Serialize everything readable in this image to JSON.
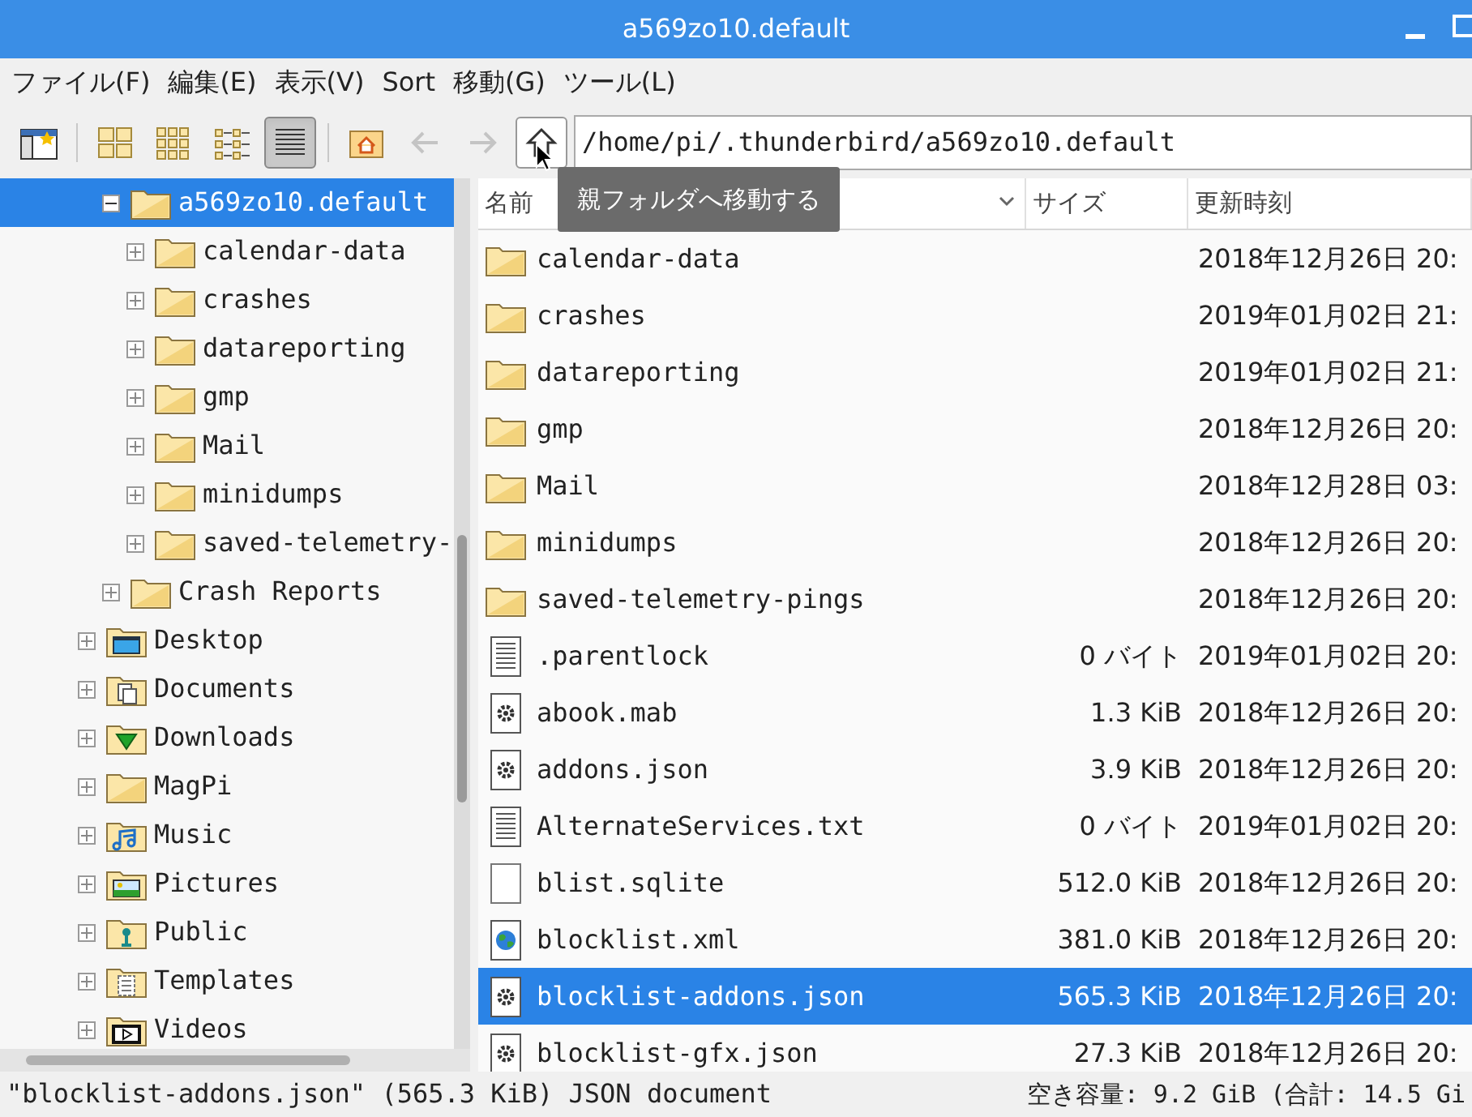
{
  "window": {
    "title": "a569zo10.default"
  },
  "menu": [
    "ファイル(F)",
    "編集(E)",
    "表示(V)",
    "Sort",
    "移動(G)",
    "ツール(L)"
  ],
  "toolbar": {
    "views": [
      {
        "kind": "icons",
        "selected": false
      },
      {
        "kind": "thumbs",
        "selected": false
      },
      {
        "kind": "compact",
        "selected": false
      },
      {
        "kind": "list",
        "selected": true
      }
    ],
    "back": {
      "disabled": true
    },
    "forward": {
      "disabled": true
    },
    "path": "/home/pi/.thunderbird/a569zo10.default",
    "tooltip": "親フォルダへ移動する"
  },
  "tree": {
    "scrolled_branch": [
      {
        "label": "a569zo10.default",
        "kind": "folder",
        "expanded": true,
        "selected": true,
        "children": [
          {
            "label": "calendar-data",
            "kind": "folder",
            "expanded": false,
            "selected": false
          },
          {
            "label": "crashes",
            "kind": "folder",
            "expanded": false,
            "selected": false
          },
          {
            "label": "datareporting",
            "kind": "folder",
            "expanded": false,
            "selected": false
          },
          {
            "label": "gmp",
            "kind": "folder",
            "expanded": false,
            "selected": false
          },
          {
            "label": "Mail",
            "kind": "folder",
            "expanded": false,
            "selected": false
          },
          {
            "label": "minidumps",
            "kind": "folder",
            "expanded": false,
            "selected": false
          },
          {
            "label": "saved-telemetry-",
            "kind": "folder",
            "expanded": false,
            "selected": false
          }
        ]
      },
      {
        "label": "Crash Reports",
        "kind": "folder",
        "expanded": false,
        "selected": false
      }
    ],
    "items": [
      {
        "label": "Desktop",
        "kind": "desktop",
        "expanded": false,
        "selected": false
      },
      {
        "label": "Documents",
        "kind": "documents",
        "expanded": false,
        "selected": false
      },
      {
        "label": "Downloads",
        "kind": "downloads",
        "expanded": false,
        "selected": false
      },
      {
        "label": "MagPi",
        "kind": "folder",
        "expanded": false,
        "selected": false
      },
      {
        "label": "Music",
        "kind": "music",
        "expanded": false,
        "selected": false
      },
      {
        "label": "Pictures",
        "kind": "pictures",
        "expanded": false,
        "selected": false
      },
      {
        "label": "Public",
        "kind": "public",
        "expanded": false,
        "selected": false
      },
      {
        "label": "Templates",
        "kind": "templates",
        "expanded": false,
        "selected": false
      },
      {
        "label": "Videos",
        "kind": "videos",
        "expanded": false,
        "selected": false
      }
    ]
  },
  "table": {
    "columns": [
      "名前",
      "サイズ",
      "更新時刻"
    ],
    "rows": [
      {
        "kind": "folder",
        "name": "calendar-data",
        "size": "",
        "date": "2018年12月26日 20:",
        "selected": false
      },
      {
        "kind": "folder",
        "name": "crashes",
        "size": "",
        "date": "2019年01月02日 21:",
        "selected": false
      },
      {
        "kind": "folder",
        "name": "datareporting",
        "size": "",
        "date": "2019年01月02日 21:",
        "selected": false
      },
      {
        "kind": "folder",
        "name": "gmp",
        "size": "",
        "date": "2018年12月26日 20:",
        "selected": false
      },
      {
        "kind": "folder",
        "name": "Mail",
        "size": "",
        "date": "2018年12月28日 03:",
        "selected": false
      },
      {
        "kind": "folder",
        "name": "minidumps",
        "size": "",
        "date": "2018年12月26日 20:",
        "selected": false
      },
      {
        "kind": "folder",
        "name": "saved-telemetry-pings",
        "size": "",
        "date": "2018年12月26日 20:",
        "selected": false
      },
      {
        "kind": "text",
        "name": ".parentlock",
        "size": "0 バイト",
        "date": "2019年01月02日 20:",
        "selected": false
      },
      {
        "kind": "gear",
        "name": "abook.mab",
        "size": "1.3 KiB",
        "date": "2018年12月26日 20:",
        "selected": false
      },
      {
        "kind": "gear",
        "name": "addons.json",
        "size": "3.9 KiB",
        "date": "2018年12月26日 20:",
        "selected": false
      },
      {
        "kind": "text",
        "name": "AlternateServices.txt",
        "size": "0 バイト",
        "date": "2019年01月02日 20:",
        "selected": false
      },
      {
        "kind": "blank",
        "name": "blist.sqlite",
        "size": "512.0 KiB",
        "date": "2018年12月26日 20:",
        "selected": false
      },
      {
        "kind": "globe",
        "name": "blocklist.xml",
        "size": "381.0 KiB",
        "date": "2018年12月26日 20:",
        "selected": false
      },
      {
        "kind": "gear",
        "name": "blocklist-addons.json",
        "size": "565.3 KiB",
        "date": "2018年12月26日 20:",
        "selected": true
      },
      {
        "kind": "gear",
        "name": "blocklist-gfx.json",
        "size": "27.3 KiB",
        "date": "2018年12月26日 20:",
        "selected": false
      }
    ]
  },
  "status_bar": {
    "selection": "\"blocklist-addons.json\" (565.3 KiB) JSON document",
    "free_space": "空き容量: 9.2 GiB (合計: 14.5 Gi"
  }
}
